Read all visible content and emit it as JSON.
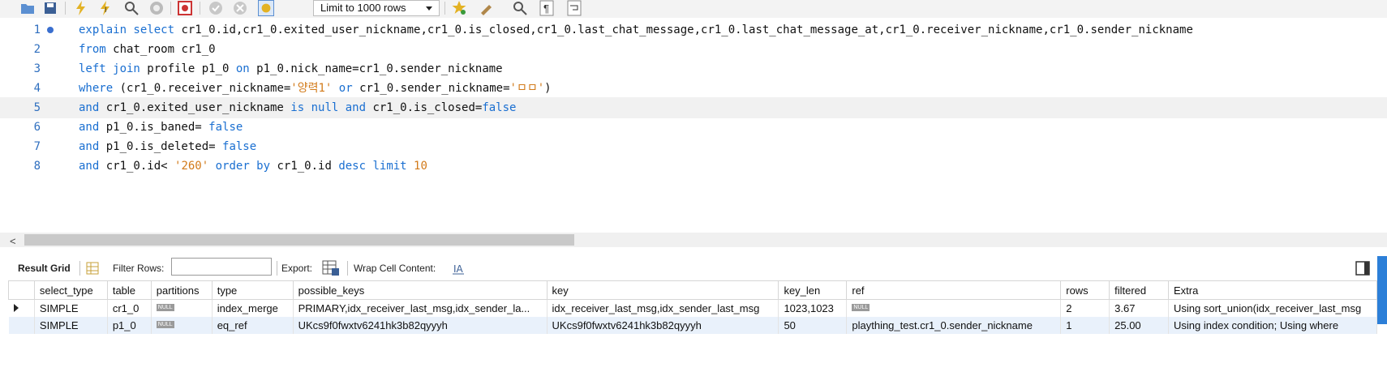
{
  "toolbar": {
    "limit_label": "Limit to 1000 rows",
    "icons": [
      "open-folder-icon",
      "save-icon",
      "execute-icon",
      "execute-current-icon",
      "explain-icon",
      "stop-icon",
      "stop-on-error-icon",
      "commit-icon",
      "rollback-icon",
      "autocommit-icon",
      "beautify-icon",
      "find-icon",
      "invisible-chars-icon",
      "wrap-icon"
    ]
  },
  "editor": {
    "lines": [
      {
        "num": "1",
        "tokens": [
          {
            "t": "explain select ",
            "c": "kw"
          },
          {
            "t": "cr1_0.id,cr1_0.exited_user_nickname,cr1_0.is_closed,cr1_0.last_chat_message,cr1_0.last_chat_message_at,cr1_0.receiver_nickname,cr1_0.sender_nickname",
            "c": ""
          }
        ]
      },
      {
        "num": "2",
        "tokens": [
          {
            "t": "from ",
            "c": "kw"
          },
          {
            "t": "chat_room cr1_0",
            "c": ""
          }
        ]
      },
      {
        "num": "3",
        "tokens": [
          {
            "t": "left join ",
            "c": "kw"
          },
          {
            "t": "profile p1_0 ",
            "c": ""
          },
          {
            "t": "on ",
            "c": "kw"
          },
          {
            "t": "p1_0.nick_name=cr1_0.sender_nickname",
            "c": ""
          }
        ]
      },
      {
        "num": "4",
        "tokens": [
          {
            "t": "where ",
            "c": "kw"
          },
          {
            "t": "(cr1_0.receiver_nickname=",
            "c": ""
          },
          {
            "t": "'양력1'",
            "c": "str"
          },
          {
            "t": " ",
            "c": ""
          },
          {
            "t": "or ",
            "c": "kw"
          },
          {
            "t": "cr1_0.sender_nickname=",
            "c": ""
          },
          {
            "t": "'ㅁㅁ'",
            "c": "str"
          },
          {
            "t": ")",
            "c": ""
          }
        ]
      },
      {
        "num": "5",
        "tokens": [
          {
            "t": "and ",
            "c": "kw"
          },
          {
            "t": "cr1_0.exited_user_nickname ",
            "c": ""
          },
          {
            "t": "is null and ",
            "c": "kw"
          },
          {
            "t": "cr1_0.is_closed=",
            "c": ""
          },
          {
            "t": "false",
            "c": "kw"
          }
        ]
      },
      {
        "num": "6",
        "tokens": [
          {
            "t": "and ",
            "c": "kw"
          },
          {
            "t": "p1_0.is_baned= ",
            "c": ""
          },
          {
            "t": "false",
            "c": "kw"
          }
        ]
      },
      {
        "num": "7",
        "tokens": [
          {
            "t": "and ",
            "c": "kw"
          },
          {
            "t": "p1_0.is_deleted= ",
            "c": ""
          },
          {
            "t": "false",
            "c": "kw"
          }
        ]
      },
      {
        "num": "8",
        "tokens": [
          {
            "t": "and ",
            "c": "kw"
          },
          {
            "t": "cr1_0.id< ",
            "c": ""
          },
          {
            "t": "'260'",
            "c": "str"
          },
          {
            "t": " ",
            "c": ""
          },
          {
            "t": "order by ",
            "c": "kw"
          },
          {
            "t": "cr1_0.id ",
            "c": ""
          },
          {
            "t": "desc limit ",
            "c": "kw"
          },
          {
            "t": "10",
            "c": "num"
          }
        ]
      }
    ]
  },
  "result_toolbar": {
    "result_grid": "Result Grid",
    "filter_rows": "Filter Rows:",
    "filter_value": "",
    "export": "Export:",
    "wrap": "Wrap Cell Content:"
  },
  "grid": {
    "columns": [
      "select_type",
      "table",
      "partitions",
      "type",
      "possible_keys",
      "key",
      "key_len",
      "ref",
      "rows",
      "filtered",
      "Extra"
    ],
    "rows": [
      [
        "SIMPLE",
        "cr1_0",
        "NULL",
        "index_merge",
        "PRIMARY,idx_receiver_last_msg,idx_sender_la...",
        "idx_receiver_last_msg,idx_sender_last_msg",
        "1023,1023",
        "NULL",
        "2",
        "3.67",
        "Using sort_union(idx_receiver_last_msg"
      ],
      [
        "SIMPLE",
        "p1_0",
        "NULL",
        "eq_ref",
        "UKcs9f0fwxtv6241hk3b82qyyyh",
        "UKcs9f0fwxtv6241hk3b82qyyyh",
        "50",
        "plaything_test.cr1_0.sender_nickname",
        "1",
        "25.00",
        "Using index condition; Using where"
      ]
    ]
  }
}
